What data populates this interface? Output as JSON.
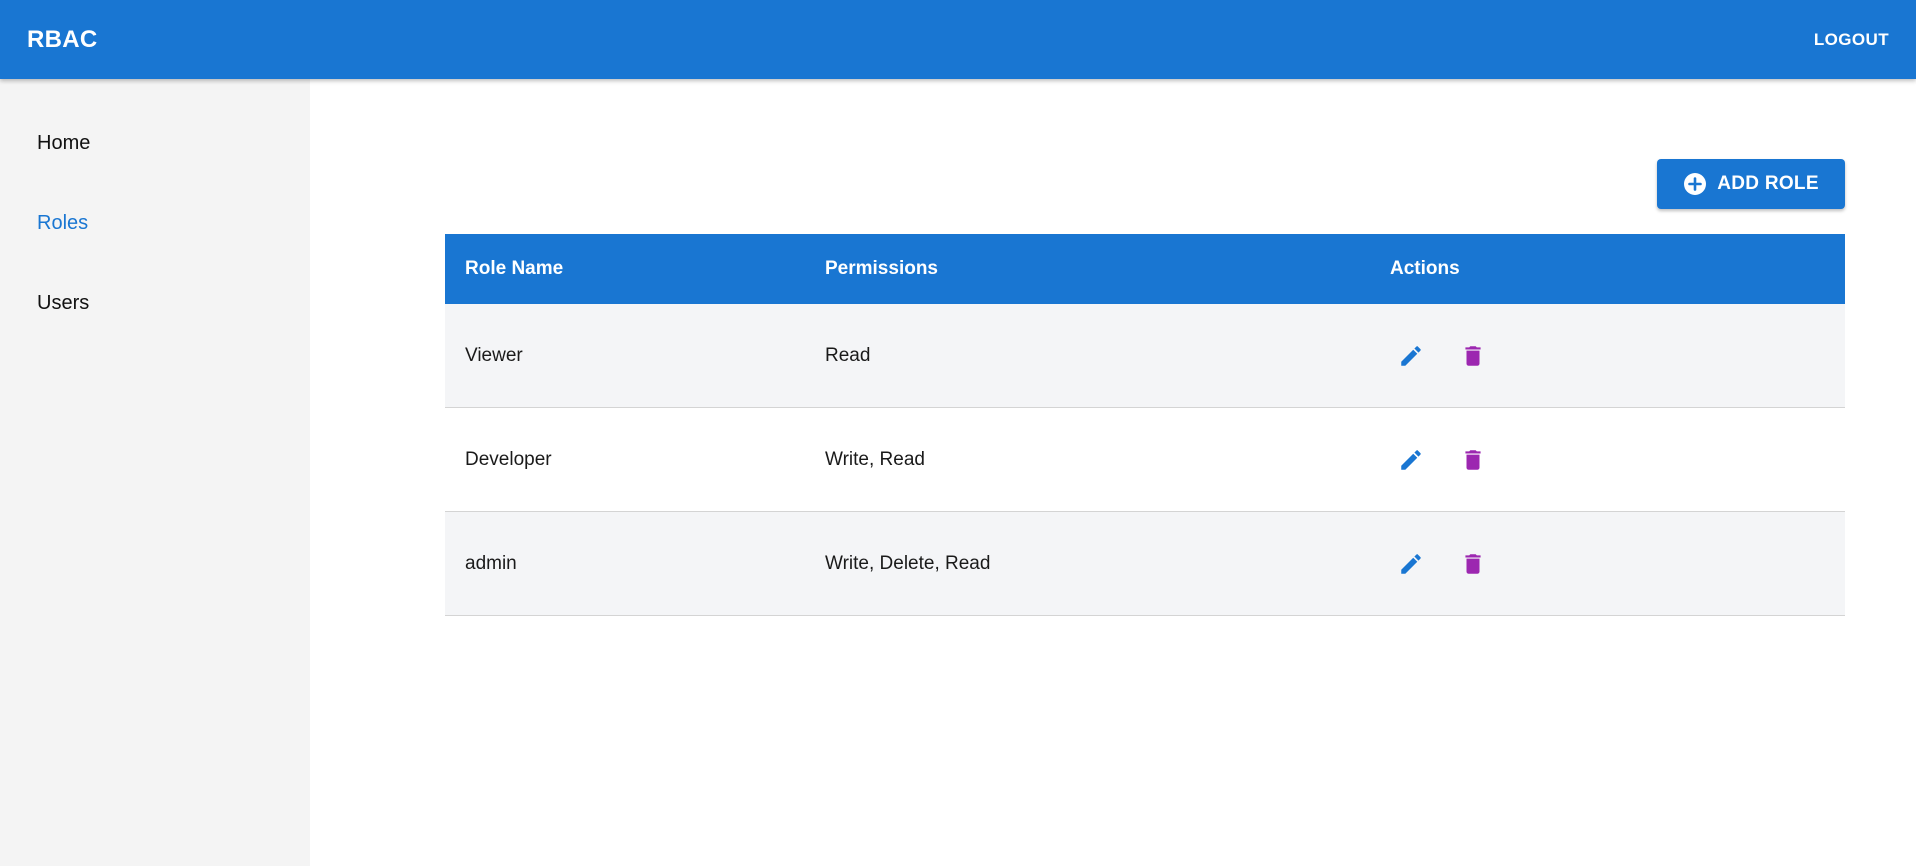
{
  "appbar": {
    "title": "RBAC",
    "logout_label": "LOGOUT"
  },
  "sidebar": {
    "items": [
      {
        "label": "Home"
      },
      {
        "label": "Roles"
      },
      {
        "label": "Users"
      }
    ],
    "active": "Roles"
  },
  "toolbar": {
    "add_label": "ADD ROLE",
    "add_icon": "add-circle-icon"
  },
  "table": {
    "columns": [
      "Role Name",
      "Permissions",
      "Actions"
    ],
    "rows": [
      {
        "role": "Viewer",
        "permissions": "Read"
      },
      {
        "role": "Developer",
        "permissions": "Write, Read"
      },
      {
        "role": "admin",
        "permissions": "Write, Delete, Read"
      }
    ],
    "action_icons": [
      "pencil-icon",
      "trash-icon"
    ]
  },
  "colors": {
    "primary": "#1976d2",
    "delete": "#9c27b0",
    "sidebar_bg": "#f4f4f4",
    "row_alt": "#f4f5f7"
  }
}
